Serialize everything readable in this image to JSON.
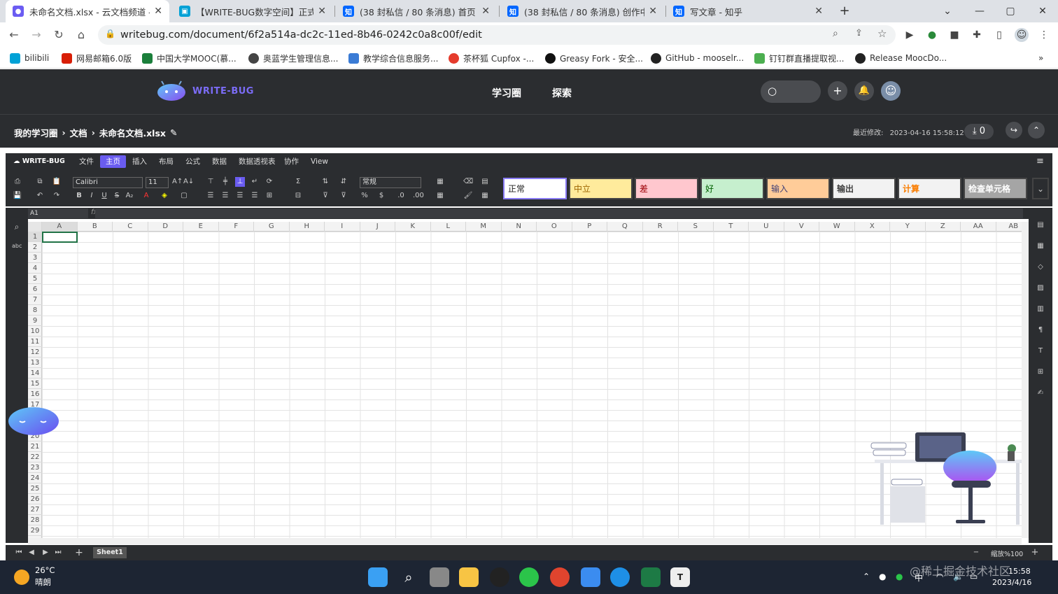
{
  "browser": {
    "tabs": [
      {
        "title": "未命名文档.xlsx - 云文档频道 - 斗",
        "active": true
      },
      {
        "title": "【WRITE-BUG数字空间】正式上",
        "active": false
      },
      {
        "title": "(38 封私信 / 80 条消息) 首页 - 知",
        "active": false
      },
      {
        "title": "(38 封私信 / 80 条消息) 创作中心",
        "active": false
      },
      {
        "title": "写文章 - 知乎",
        "active": false
      }
    ],
    "url": "writebug.com/document/6f2a514a-dc2c-11ed-8b46-0242c0a8c00f/edit",
    "bookmarks": [
      "bilibili",
      "网易邮箱6.0版",
      "中国大学MOOC(慕...",
      "奥蓝学生管理信息...",
      "教学综合信息服务...",
      "茶杯狐 Cupfox -...",
      "Greasy Fork - 安全...",
      "GitHub - mooselr...",
      "钉钉群直播提取视...",
      "Release MoocDo..."
    ]
  },
  "site": {
    "logo": "WRITE-BUG",
    "nav": [
      "学习圈",
      "探索"
    ]
  },
  "doc": {
    "breadcrumb": [
      "我的学习圈",
      "文档",
      "未命名文档.xlsx"
    ],
    "last_modified_label": "最近修改:",
    "last_modified": "2023-04-16 15:58:12",
    "download_count": "0"
  },
  "ribbon": {
    "brand": "WRITE-BUG",
    "menus": [
      "文件",
      "主页",
      "插入",
      "布局",
      "公式",
      "数据",
      "数据透视表",
      "协作",
      "View"
    ],
    "selected_menu": "主页",
    "font": "Calibri",
    "font_size": "11",
    "number_format": "常规",
    "cell_styles": [
      {
        "label": "正常",
        "bg": "#ffffff",
        "fg": "#222222"
      },
      {
        "label": "中立",
        "bg": "#ffeb9c",
        "fg": "#9c6500"
      },
      {
        "label": "差",
        "bg": "#ffc7ce",
        "fg": "#9c0006"
      },
      {
        "label": "好",
        "bg": "#c6efce",
        "fg": "#006100"
      },
      {
        "label": "输入",
        "bg": "#ffcc99",
        "fg": "#3f3f76"
      },
      {
        "label": "输出",
        "bg": "#f2f2f2",
        "fg": "#3f3f3f"
      },
      {
        "label": "计算",
        "bg": "#f2f2f2",
        "fg": "#fa7d00"
      },
      {
        "label": "检查单元格",
        "bg": "#a5a5a5",
        "fg": "#ffffff"
      }
    ]
  },
  "formula": {
    "name_box": "A1",
    "fx": "fx"
  },
  "grid": {
    "columns": [
      "A",
      "B",
      "C",
      "D",
      "E",
      "F",
      "G",
      "H",
      "I",
      "J",
      "K",
      "L",
      "M",
      "N",
      "O",
      "P",
      "Q",
      "R",
      "S",
      "T",
      "U",
      "V",
      "W",
      "X",
      "Y",
      "Z",
      "AA",
      "AB"
    ],
    "rows": [
      "1",
      "2",
      "3",
      "4",
      "5",
      "6",
      "7",
      "8",
      "9",
      "10",
      "11",
      "12",
      "13",
      "14",
      "15",
      "16",
      "17",
      "18",
      "19",
      "20",
      "21",
      "22",
      "23",
      "24",
      "25",
      "26",
      "27",
      "28",
      "29"
    ]
  },
  "sheets": [
    "Sheet1"
  ],
  "zoom": "缩放%100",
  "taskbar": {
    "weather_temp": "26°C",
    "weather_desc": "晴朗",
    "time": "15:58",
    "date": "2023/4/16",
    "ime": "中",
    "watermark": "@稀土掘金技术社区"
  }
}
